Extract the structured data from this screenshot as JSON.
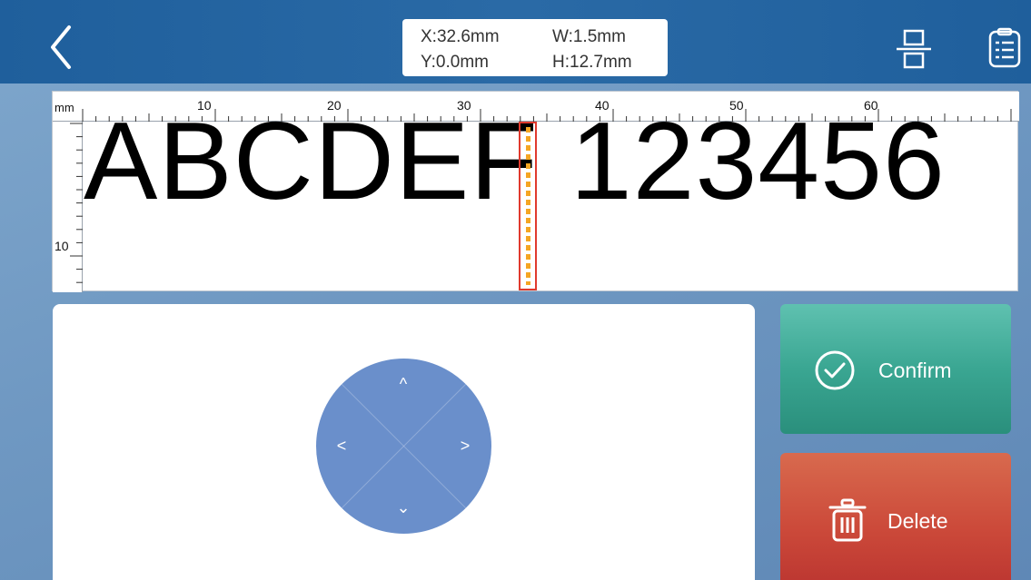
{
  "header": {
    "back_icon": "chevron-left-icon",
    "coords": {
      "x_label": "X:32.6mm",
      "y_label": "Y:0.0mm",
      "w_label": "W:1.5mm",
      "h_label": "H:12.7mm"
    },
    "align_icon": "align-center-icon",
    "list_icon": "list-icon"
  },
  "canvas": {
    "ruler_unit": "mm",
    "top_ruler_numbers": [
      "10",
      "20",
      "30",
      "40",
      "50",
      "60"
    ],
    "left_ruler_numbers": [
      "10"
    ],
    "print_text": "ABCDEF 123456",
    "selection_color": "#e03a2e",
    "selection_fill_color": "#f5a623"
  },
  "control_pad": {
    "up_icon": "chevron-up-icon",
    "down_icon": "chevron-down-icon",
    "left_icon": "chevron-left-icon",
    "right_icon": "chevron-right-icon",
    "up_glyph": "^",
    "down_glyph": "⌄",
    "left_glyph": "<",
    "right_glyph": ">",
    "color": "#6a8fcb"
  },
  "actions": {
    "confirm_label": "Confirm",
    "confirm_icon": "check-circle-icon",
    "confirm_color": "#3aa692",
    "delete_label": "Delete",
    "delete_icon": "trash-icon",
    "delete_color": "#cc4a3a"
  }
}
